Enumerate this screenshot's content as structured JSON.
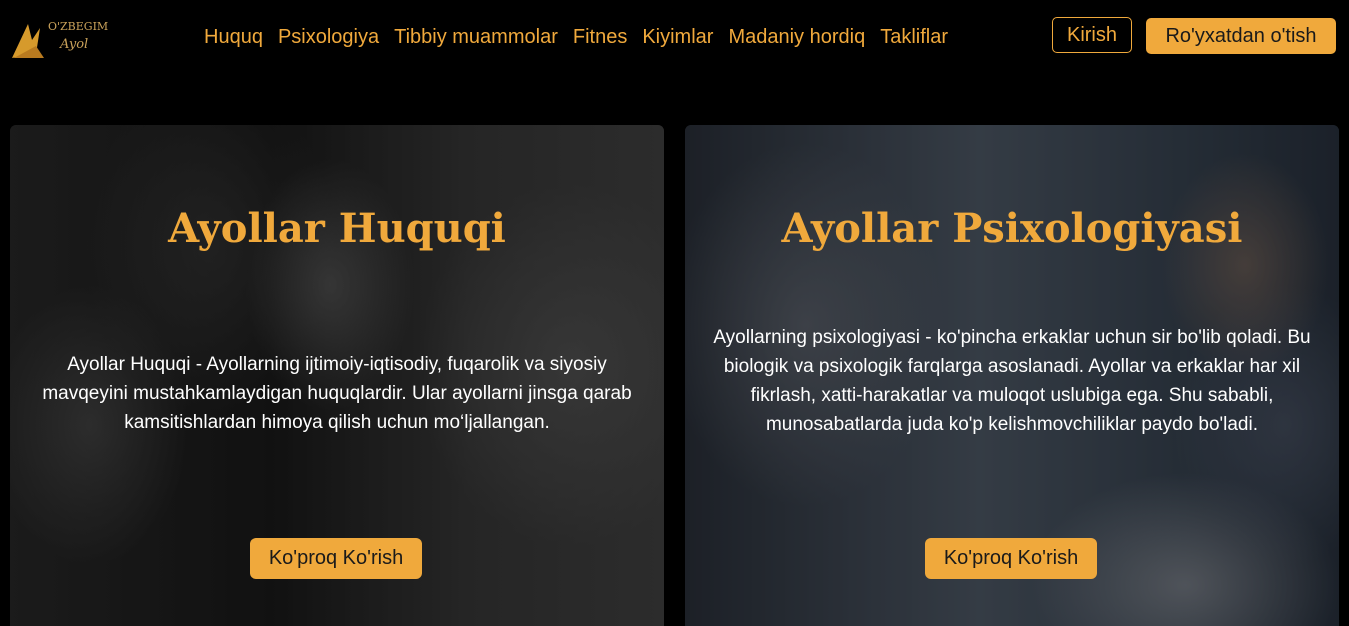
{
  "logo": {
    "alt": "O'zbegim Ayol",
    "icon": "logo-icon"
  },
  "nav": {
    "links": [
      "Huquq",
      "Psixologiya",
      "Tibbiy muammolar",
      "Fitnes",
      "Kiyimlar",
      "Madaniy hordiq",
      "Takliflar"
    ],
    "login_label": "Kirish",
    "register_label": "Ro'yxatdan o'tish"
  },
  "cards": [
    {
      "title": "Ayollar Huquqi",
      "text": "Ayollar Huquqi - Ayollarning ijtimoiy-iqtisodiy, fuqarolik va siyosiy mavqeyini mustahkamlaydigan huquqlardir. Ular ayollarni jinsga qarab kamsitishlardan himoya qilish uchun mo‘ljallangan.",
      "button": "Ko'proq Ko'rish"
    },
    {
      "title": "Ayollar Psixologiyasi",
      "text": "Ayollarning psixologiyasi - ko'pincha erkaklar uchun sir bo'lib qoladi. Bu biologik va psixologik farqlarga asoslanadi. Ayollar va erkaklar har xil fikrlash, xatti-harakatlar va muloqot uslubiga ega. Shu sababli, munosabatlarda juda ko'p kelishmovchiliklar paydo bo'ladi.",
      "button": "Ko'proq Ko'rish"
    }
  ],
  "colors": {
    "accent": "#f0a93c",
    "background": "#000000"
  }
}
